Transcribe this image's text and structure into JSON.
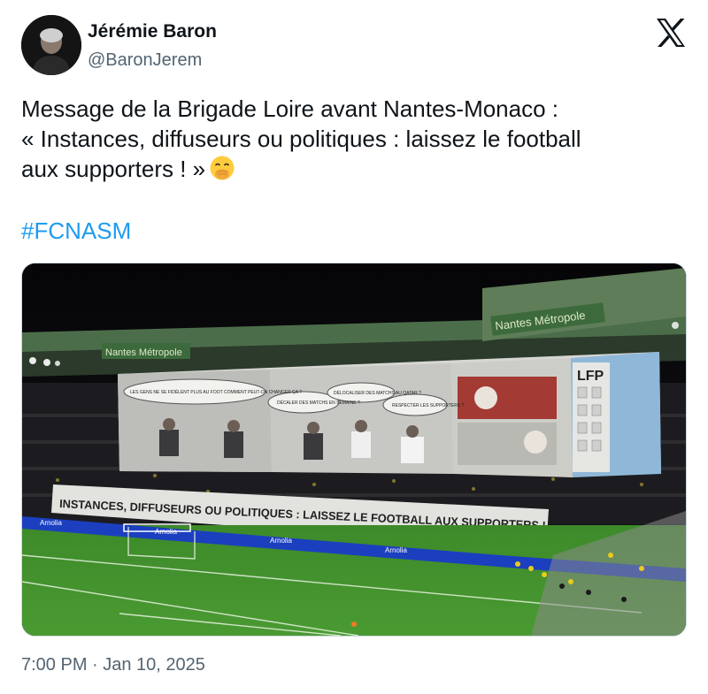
{
  "author": {
    "name": "Jérémie Baron",
    "handle": "@BaronJerem"
  },
  "tweet": {
    "line1": "Message de la Brigade Loire avant Nantes-Monaco :",
    "line2": "« Instances, diffuseurs ou politiques : laissez le football",
    "line3": "aux supporters ! »",
    "emoji": "face-with-hand-over-mouth-emoji",
    "hashtag": "#FCNASM"
  },
  "media": {
    "stadium_signs": [
      "Nantes Métropole",
      "Nantes Métropole"
    ],
    "banner_text": "INSTANCES, DIFFUSEURS OU POLITIQUES : LAISSEZ LE FOOTBALL AUX SUPPORTERS !",
    "tifo_bubbles": [
      "LES GENS NE SE FIDÈLENT PLUS AU FOOT COMMENT PEUT-ON CHANGER ÇA ?",
      "DÉCALER DES MATCHS EN SEMAINE ?",
      "DÉLOCALISER DES MATCHS AU QATAR ?",
      "RESPECTER LES SUPPORTERS ?"
    ],
    "tifo_sign": "LFP",
    "ad_board": "Arnolia"
  },
  "timestamp": "7:00 PM · Jan 10, 2025",
  "colors": {
    "text": "#0f1419",
    "secondary": "#536471",
    "link": "#1d9bf0",
    "border": "#cfd9de",
    "pitch": "#3f8a2c",
    "adboard": "#1b3fbf"
  }
}
